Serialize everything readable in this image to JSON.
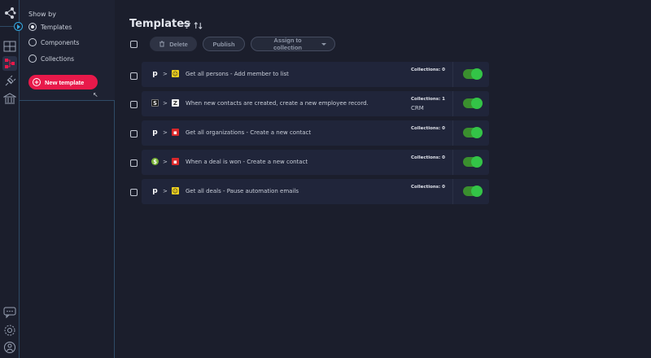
{
  "sidebar": {
    "icons": [
      "share-network-icon",
      "dashboard-icon",
      "templates-icon",
      "plug-icon",
      "bank-icon",
      "chat-icon",
      "gear-icon",
      "user-icon"
    ]
  },
  "filter": {
    "show_by_label": "Show by",
    "options": [
      {
        "label": "Templates",
        "selected": true
      },
      {
        "label": "Components",
        "selected": false
      },
      {
        "label": "Collections",
        "selected": false
      }
    ],
    "new_template_label": "New template"
  },
  "main": {
    "title": "Templates",
    "toolbar": {
      "delete_label": "Delete",
      "publish_label": "Publish",
      "assign_label": "Assign to collection"
    },
    "rows": [
      {
        "from": "p",
        "to": "mailchimp",
        "desc": "Get all persons - Add member to list",
        "collections": "Collections: 0",
        "collection_name": "",
        "enabled": true
      },
      {
        "from": "squarespace",
        "to": "pipefy",
        "desc": "When new contacts are created, create a new employee record.",
        "collections": "Collections: 1",
        "collection_name": "CRM",
        "enabled": true
      },
      {
        "from": "p",
        "to": "bar",
        "desc": "Get all organizations - Create a new contact",
        "collections": "Collections: 0",
        "collection_name": "",
        "enabled": true
      },
      {
        "from": "green",
        "to": "bar",
        "desc": "When a deal is won - Create a new contact",
        "collections": "Collections: 0",
        "collection_name": "",
        "enabled": true
      },
      {
        "from": "p",
        "to": "mailchimp",
        "desc": "Get all deals - Pause automation emails",
        "collections": "Collections: 0",
        "collection_name": "",
        "enabled": true
      }
    ],
    "row_arrow": ">"
  },
  "colors": {
    "accent": "#e8194a",
    "toggle_on": "#33c447",
    "border": "#2f4b66"
  }
}
